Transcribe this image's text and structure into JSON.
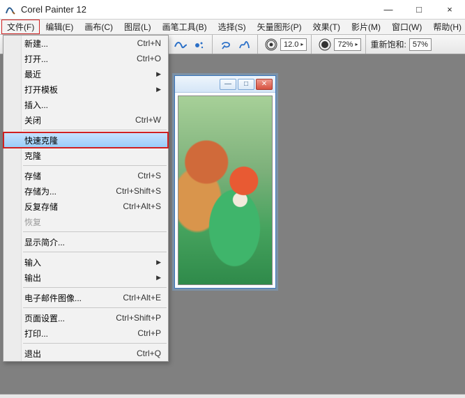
{
  "app": {
    "title": "Corel Painter 12"
  },
  "window_controls": {
    "min": "—",
    "max": "□",
    "close": "×"
  },
  "menubar": [
    {
      "id": "file",
      "label": "文件(F)",
      "active": true
    },
    {
      "id": "edit",
      "label": "编辑(E)"
    },
    {
      "id": "canvas",
      "label": "画布(C)"
    },
    {
      "id": "layer",
      "label": "图层(L)"
    },
    {
      "id": "brush",
      "label": "画笔工具(B)"
    },
    {
      "id": "select",
      "label": "选择(S)"
    },
    {
      "id": "vector",
      "label": "矢量图形(P)"
    },
    {
      "id": "effect",
      "label": "效果(T)"
    },
    {
      "id": "movie",
      "label": "影片(M)"
    },
    {
      "id": "window",
      "label": "窗口(W)"
    },
    {
      "id": "help",
      "label": "帮助(H)"
    }
  ],
  "toolbar": {
    "size_value": "12.0",
    "opacity_value": "72%",
    "resat_label": "重新饱和:",
    "resat_value": "57%"
  },
  "file_menu": [
    {
      "id": "new",
      "label": "新建...",
      "shortcut": "Ctrl+N"
    },
    {
      "id": "open",
      "label": "打开...",
      "shortcut": "Ctrl+O"
    },
    {
      "id": "recent",
      "label": "最近",
      "submenu": true
    },
    {
      "id": "open_tmpl",
      "label": "打开模板",
      "submenu": true
    },
    {
      "id": "insert",
      "label": "插入..."
    },
    {
      "id": "close",
      "label": "关闭",
      "shortcut": "Ctrl+W"
    },
    {
      "sep": true
    },
    {
      "id": "quickclone",
      "label": "快速克隆",
      "hover": true,
      "red": true
    },
    {
      "id": "clone",
      "label": "克隆"
    },
    {
      "sep": true
    },
    {
      "id": "save",
      "label": "存储",
      "shortcut": "Ctrl+S"
    },
    {
      "id": "saveas",
      "label": "存储为...",
      "shortcut": "Ctrl+Shift+S"
    },
    {
      "id": "itersave",
      "label": "反复存储",
      "shortcut": "Ctrl+Alt+S"
    },
    {
      "id": "revert",
      "label": "恢复",
      "disabled": true
    },
    {
      "sep": true
    },
    {
      "id": "showinfo",
      "label": "显示简介..."
    },
    {
      "sep": true
    },
    {
      "id": "import",
      "label": "输入",
      "submenu": true
    },
    {
      "id": "export",
      "label": "输出",
      "submenu": true
    },
    {
      "sep": true
    },
    {
      "id": "emailimg",
      "label": "电子邮件图像...",
      "shortcut": "Ctrl+Alt+E"
    },
    {
      "sep": true
    },
    {
      "id": "pagesetup",
      "label": "页面设置...",
      "shortcut": "Ctrl+Shift+P"
    },
    {
      "id": "print",
      "label": "打印...",
      "shortcut": "Ctrl+P"
    },
    {
      "sep": true
    },
    {
      "id": "exit",
      "label": "退出",
      "shortcut": "Ctrl+Q"
    }
  ]
}
